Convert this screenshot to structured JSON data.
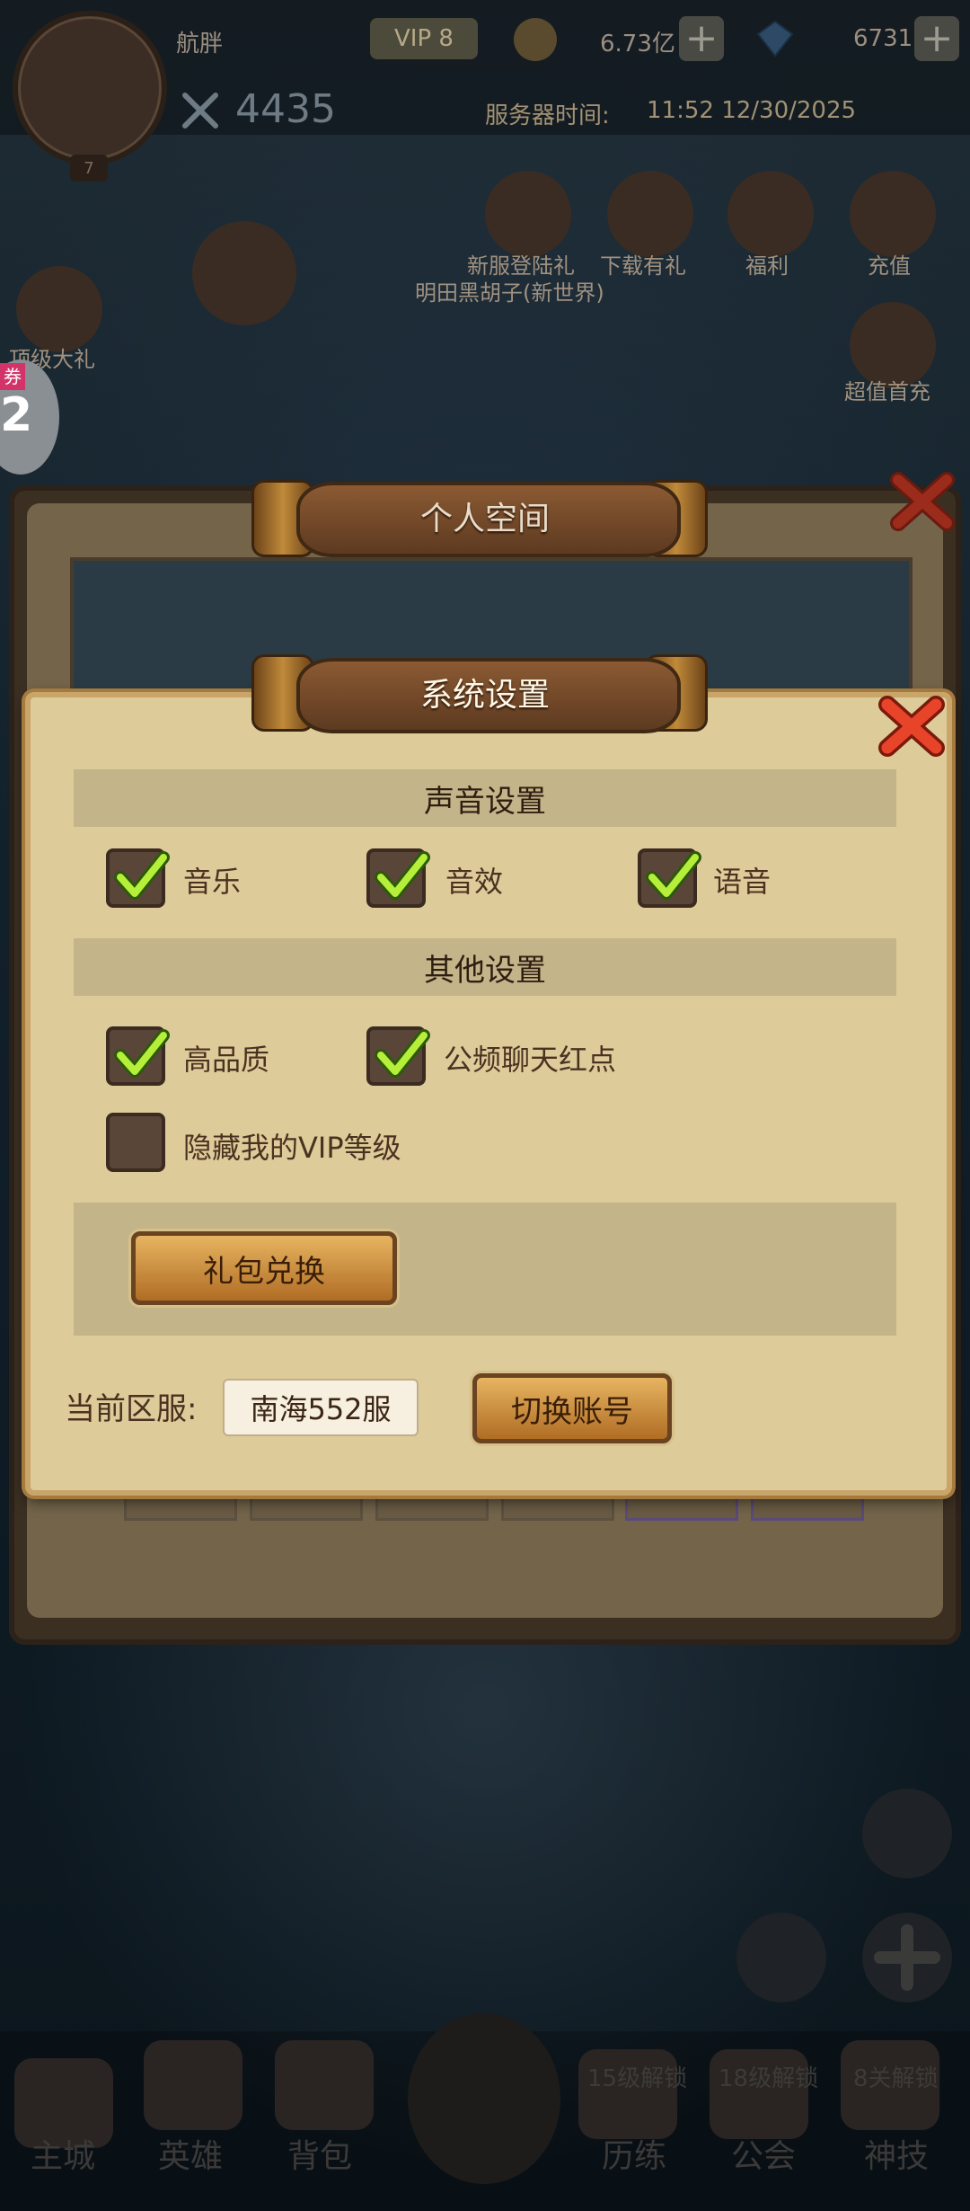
{
  "hud": {
    "player_name": "航胖",
    "vip_label": "VIP 8",
    "gold": "6.73亿",
    "diamonds": "6731",
    "level": "7",
    "power": "4435",
    "server_time_label": "服务器时间:",
    "server_time_value": "11:52 12/30/2025"
  },
  "events": [
    {
      "label": "新服登陆礼"
    },
    {
      "label": "下载有礼"
    },
    {
      "label": "福利"
    },
    {
      "label": "充值"
    },
    {
      "label": "超值首充"
    }
  ],
  "event_subtitle": "明田黑胡子(新世界)",
  "left_event_label": "顶级大礼",
  "coupon": {
    "tag": "券",
    "number": "2"
  },
  "back_panel": {
    "title": "个人空间"
  },
  "dialog": {
    "title": "系统设置",
    "sound_section": "声音设置",
    "sound_options": [
      {
        "label": "音乐",
        "checked": true
      },
      {
        "label": "音效",
        "checked": true
      },
      {
        "label": "语音",
        "checked": true
      }
    ],
    "other_section": "其他设置",
    "other_options": [
      {
        "label": "高品质",
        "checked": true
      },
      {
        "label": "公频聊天红点",
        "checked": true
      },
      {
        "label": "隐藏我的VIP等级",
        "checked": false
      }
    ],
    "gift_button": "礼包兑换",
    "server_label": "当前区服:",
    "server_value": "南海552服",
    "switch_account_button": "切换账号"
  },
  "bottom_nav": [
    {
      "label": "主城"
    },
    {
      "label": "英雄"
    },
    {
      "label": "背包"
    },
    {
      "label": ""
    },
    {
      "label": "历练",
      "lock": "15级解锁"
    },
    {
      "label": "公会",
      "lock": "18级解锁"
    },
    {
      "label": "神技",
      "lock": "8关解锁"
    }
  ]
}
